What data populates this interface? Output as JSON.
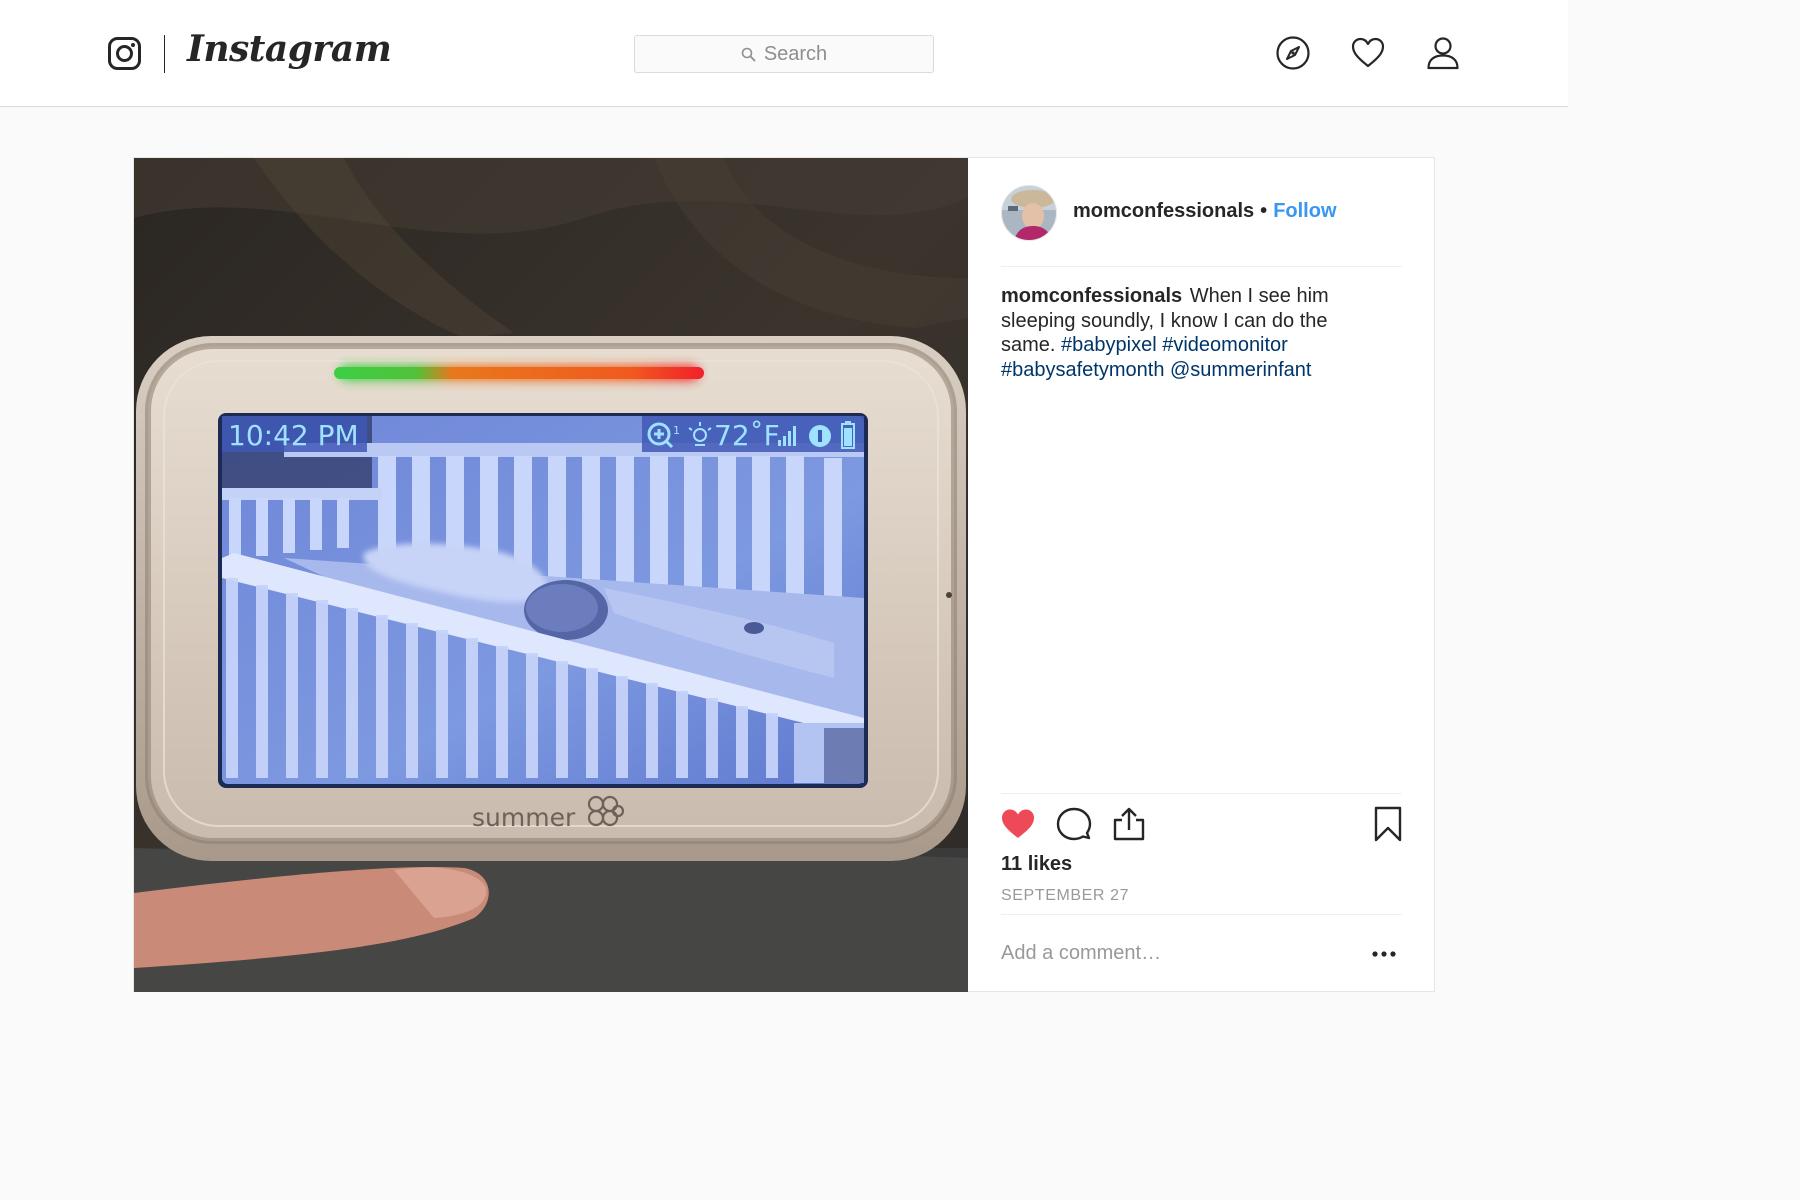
{
  "header": {
    "logo_text": "Instagram",
    "search_placeholder": "Search"
  },
  "post": {
    "username": "momconfessionals",
    "follow_label": "Follow",
    "caption": {
      "username": "momconfessionals",
      "text": "When I see him sleeping soundly, I know I can do the same.",
      "hashtags": [
        "#babypixel",
        "#videomonitor",
        "#babysafetymonth"
      ],
      "mention": "@summerinfant"
    },
    "likes": "11 likes",
    "liked": true,
    "date": "SEPTEMBER 27",
    "comment_placeholder": "Add a comment…",
    "like_color": "#ed4956",
    "link_color": "#3897f0",
    "hashtag_color": "#003569"
  },
  "monitor": {
    "time": "10:42 PM",
    "zoom": "1",
    "temperature": "72˚F",
    "brand": "summer"
  }
}
